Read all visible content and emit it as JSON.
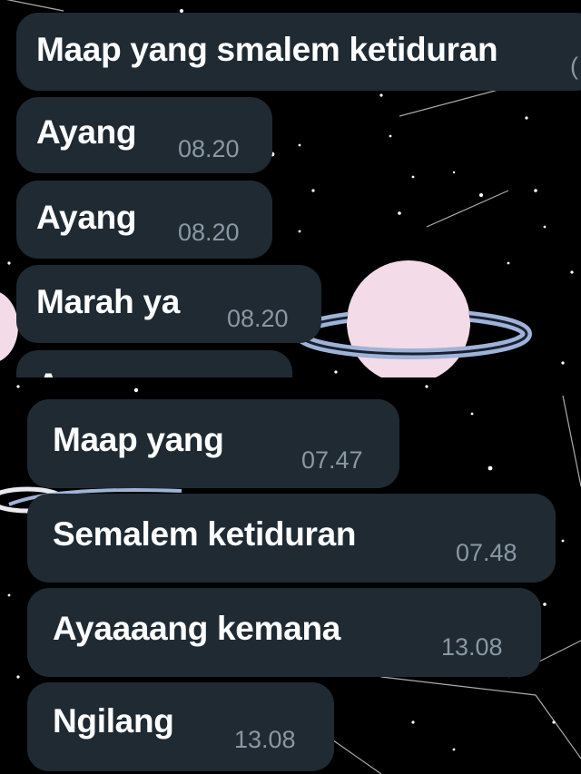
{
  "chat_top": {
    "messages": [
      {
        "text": "Maap yang smalem ketiduran",
        "time": ""
      },
      {
        "text": "Ayang",
        "time": "08.20"
      },
      {
        "text": "Ayang",
        "time": "08.20"
      },
      {
        "text": "Marah ya",
        "time": "08.20"
      },
      {
        "text": "Ayang",
        "time": ""
      }
    ]
  },
  "chat_bottom": {
    "messages": [
      {
        "text": "Maap yang",
        "time": "07.47"
      },
      {
        "text": "Semalem ketiduran",
        "time": "07.48"
      },
      {
        "text": "Ayaaaang kemana",
        "time": "13.08"
      },
      {
        "text": "Ngilang",
        "time": "13.08"
      }
    ]
  },
  "colors": {
    "bubble": "#1f2a33",
    "timestamp": "#8a98a3",
    "background": "#000000",
    "planet": "#f3dbe8",
    "ring": "#9fb3d8"
  }
}
